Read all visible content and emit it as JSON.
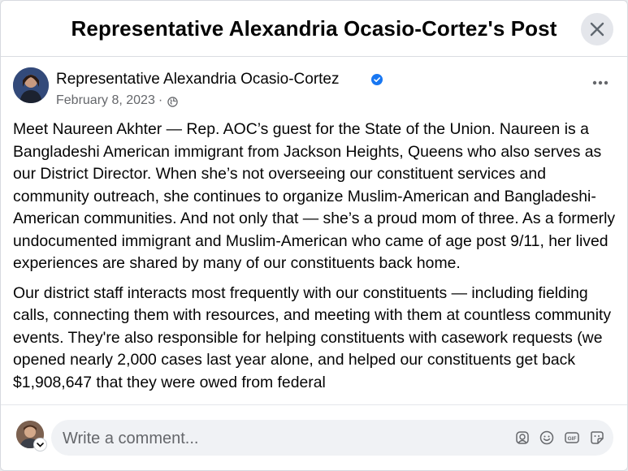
{
  "dialog": {
    "title": "Representative Alexandria Ocasio-Cortez's Post"
  },
  "post": {
    "author": "Representative Alexandria Ocasio-Cortez",
    "date": "February 8, 2023",
    "separator": "·",
    "paragraphs": [
      "Meet Naureen Akhter — Rep. AOC’s guest for the State of the Union. Naureen is a Bangladeshi American immigrant from Jackson Heights, Queens who also serves as our District Director. When she’s not overseeing our constituent services and community outreach, she continues to organize Muslim-American and Bangladeshi-American communities. And not only that — she’s a proud mom of three. As a formerly undocumented immigrant and Muslim-American who came of age post 9/11, her lived experiences are shared by many of our constituents back home.",
      "Our district staff interacts most frequently with our constituents — including fielding calls, connecting them with resources, and meeting with them at countless community events. They're also responsible for helping constituents with casework requests (we opened nearly 2,000 cases last year alone, and helped our constituents get back $1,908,647 that they were owed from federal"
    ]
  },
  "comment": {
    "placeholder": "Write a comment..."
  },
  "icons": {
    "close": "close-icon",
    "verified": "verified-badge-icon",
    "audience": "globe-icon",
    "more": "more-options-icon",
    "avatar_sticker": "avatar-sticker-icon",
    "emoji": "emoji-icon",
    "gif": "gif-icon",
    "sticker": "sticker-icon"
  },
  "colors": {
    "accent": "#1877f2",
    "secondary_text": "#65676b",
    "input_bg": "#f0f2f5"
  }
}
